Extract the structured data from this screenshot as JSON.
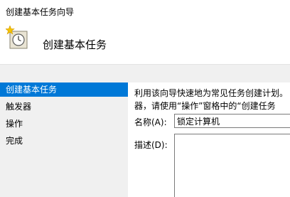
{
  "window": {
    "title": "创建基本任务向导"
  },
  "header": {
    "icon": "scheduled-task-clock-icon",
    "heading": "创建基本任务"
  },
  "steps": [
    {
      "label": "创建基本任务",
      "active": true
    },
    {
      "label": "触发器",
      "active": false
    },
    {
      "label": "操作",
      "active": false
    },
    {
      "label": "完成",
      "active": false
    }
  ],
  "content": {
    "description_line1": "利用该向导快速地为常见任务创建计划。",
    "description_line2": "器，请使用“操作”窗格中的“创建任务",
    "name_label": "名称(A):",
    "name_value": "锁定计算机",
    "desc_label": "描述(D):",
    "desc_value": ""
  },
  "colors": {
    "accent": "#0078d7",
    "background": "#f0f0f0",
    "panel": "#ffffff"
  }
}
